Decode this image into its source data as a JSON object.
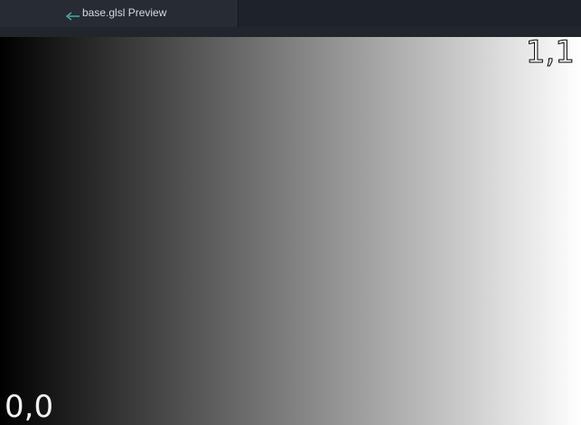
{
  "tab": {
    "icon": "glsl-file-icon",
    "title": "base.glsl Preview"
  },
  "preview": {
    "gradient": {
      "start_color": "#000000",
      "end_color": "#ffffff",
      "direction": "left-to-right"
    },
    "labels": {
      "origin": "0,0",
      "max": "1,1"
    }
  }
}
